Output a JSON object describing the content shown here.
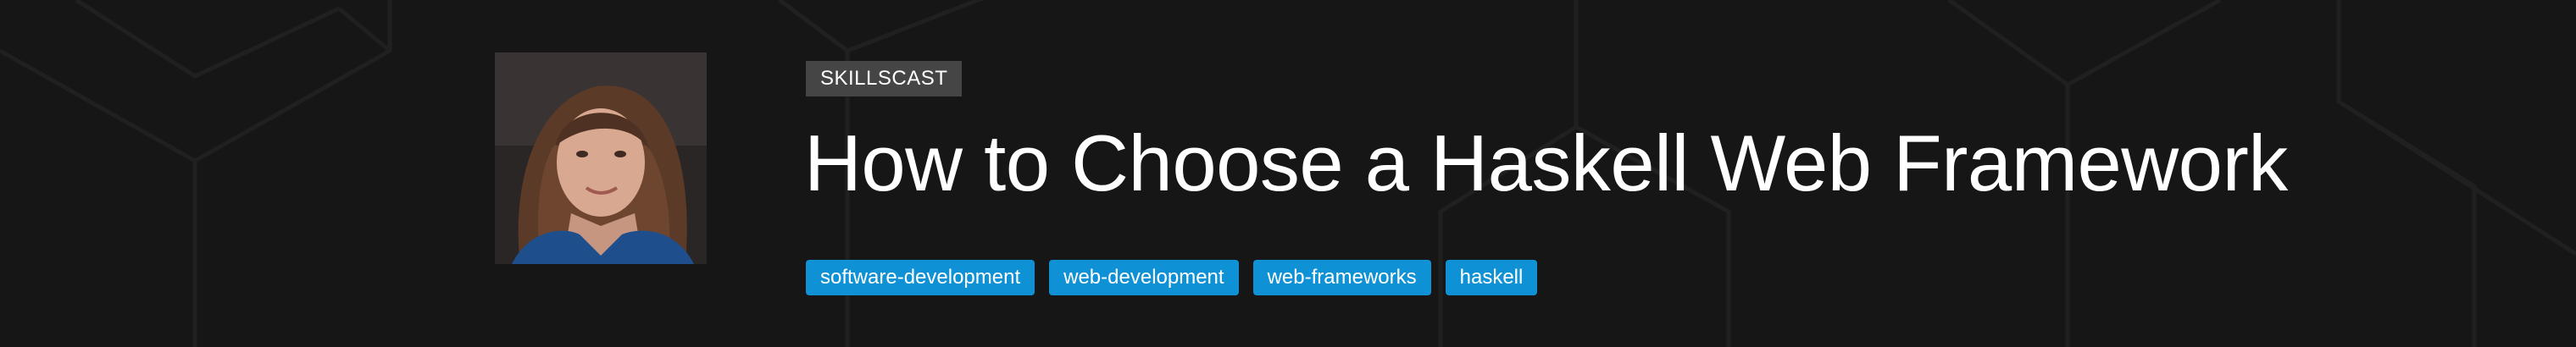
{
  "hero": {
    "label": "SKILLSCAST",
    "title": "How to Choose a Haskell Web Framework",
    "tags": [
      {
        "label": "software-development"
      },
      {
        "label": "web-development"
      },
      {
        "label": "web-frameworks"
      },
      {
        "label": "haskell"
      }
    ]
  },
  "colors": {
    "background": "#161616",
    "badge": "#454545",
    "tag": "#0f91d6",
    "text": "#ffffff"
  }
}
